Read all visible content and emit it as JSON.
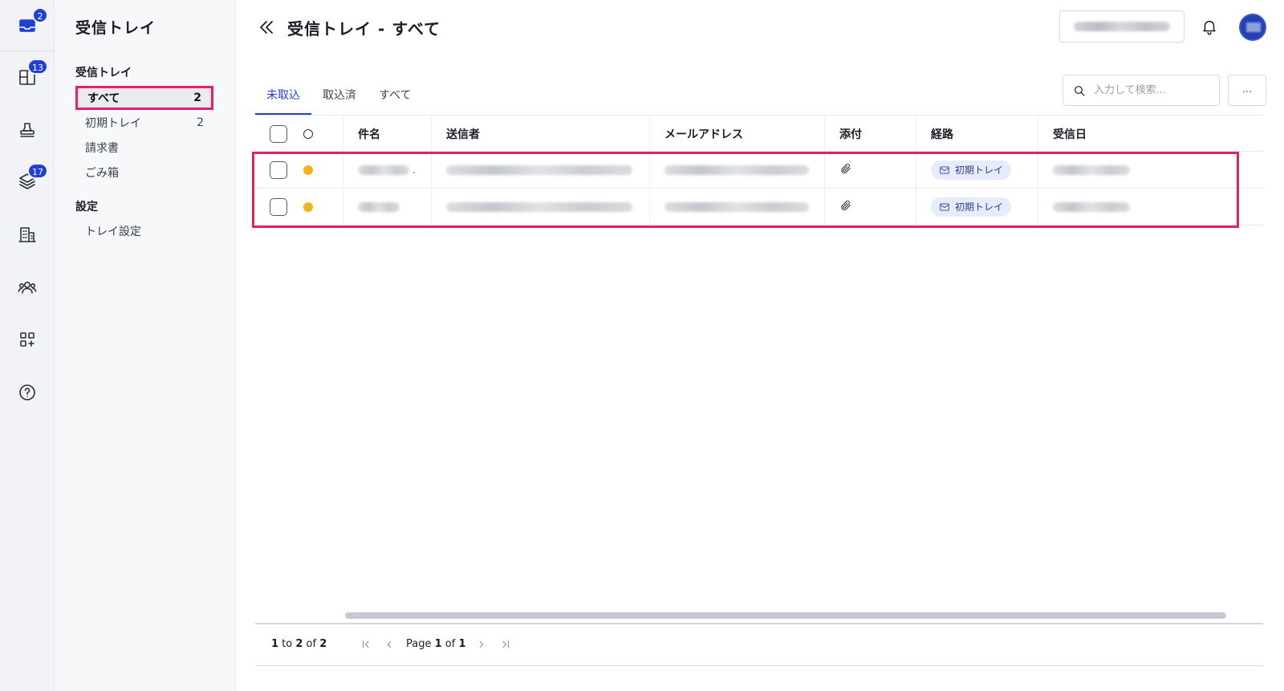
{
  "rail": {
    "items": [
      {
        "name": "inbox-icon",
        "badge": "2"
      },
      {
        "name": "layout-icon",
        "badge": "13"
      },
      {
        "name": "stamp-icon",
        "badge": ""
      },
      {
        "name": "layers-icon",
        "badge": "17"
      },
      {
        "name": "building-icon",
        "badge": ""
      },
      {
        "name": "users-icon",
        "badge": ""
      },
      {
        "name": "apps-add-icon",
        "badge": ""
      },
      {
        "name": "help-icon",
        "badge": ""
      }
    ]
  },
  "sidebar": {
    "title": "受信トレイ",
    "section_inbox": "受信トレイ",
    "items": [
      {
        "label": "すべて",
        "count": "2"
      },
      {
        "label": "初期トレイ",
        "count": "2"
      },
      {
        "label": "請求書",
        "count": ""
      },
      {
        "label": "ごみ箱",
        "count": ""
      }
    ],
    "section_settings": "設定",
    "settings_items": [
      {
        "label": "トレイ設定"
      }
    ]
  },
  "header": {
    "title": "受信トレイ - すべて"
  },
  "tabs": [
    {
      "label": "未取込"
    },
    {
      "label": "取込済"
    },
    {
      "label": "すべて"
    }
  ],
  "search": {
    "placeholder": "入力して検索..."
  },
  "more_label": "...",
  "table": {
    "columns": [
      "件名",
      "送信者",
      "メールアドレス",
      "添付",
      "経路",
      "受信日"
    ],
    "rows": [
      {
        "subject_tail": ".",
        "route": "初期トレイ"
      },
      {
        "subject_tail": "",
        "route": "初期トレイ"
      }
    ]
  },
  "pager": {
    "from": "1",
    "to_word": " to ",
    "to": "2",
    "of_word": " of ",
    "total": "2",
    "page_word": "Page ",
    "page": "1",
    "page_of_word": " of ",
    "page_total": "1"
  },
  "colors": {
    "accent": "#1f3fd6",
    "highlight": "#ea1e63",
    "unread_dot": "#f0b31c"
  }
}
